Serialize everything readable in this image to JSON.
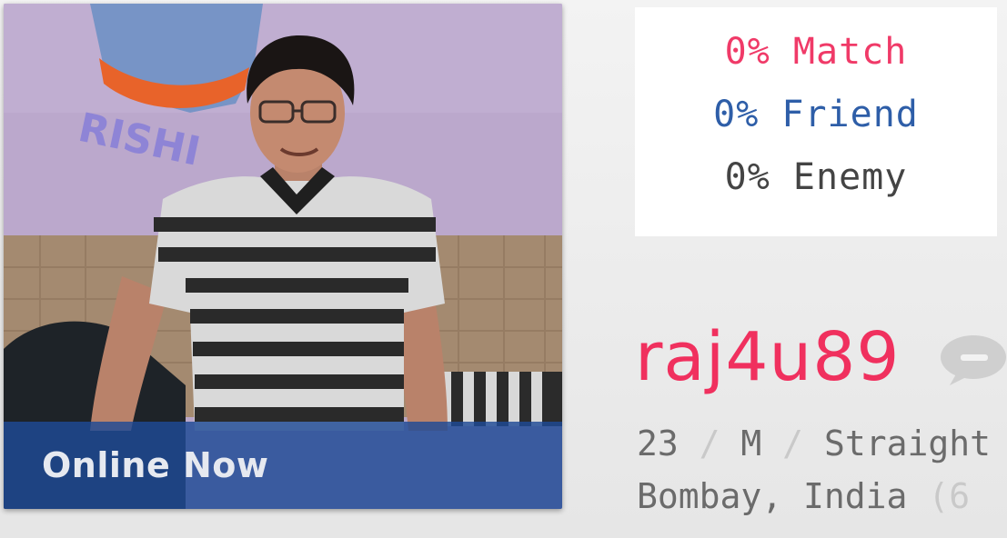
{
  "photo": {
    "banner_text": "RISHI",
    "status_label": "Online Now"
  },
  "match": {
    "match_label": "0% Match",
    "friend_label": "0% Friend",
    "enemy_label": "0% Enemy",
    "colors": {
      "match": "#f03a68",
      "friend": "#2e5ea8",
      "enemy": "#444444"
    }
  },
  "profile": {
    "username": "raj4u89",
    "age": "23",
    "separator": " / ",
    "gender": "M",
    "orientation": "Straight",
    "location": "Bombay, India",
    "distance_fragment": "(6"
  },
  "icons": {
    "chat": "chat-bubble-icon"
  }
}
